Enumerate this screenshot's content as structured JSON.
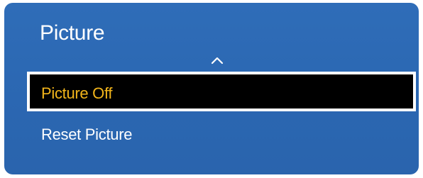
{
  "menu": {
    "title": "Picture",
    "scroll_up_icon": "chevron-up-icon",
    "items": [
      {
        "label": "Picture Off",
        "selected": true
      },
      {
        "label": "Reset Picture",
        "selected": false
      }
    ]
  },
  "colors": {
    "panel_background": "#2b67b2",
    "selected_background": "#000000",
    "selected_text": "#f2b51b",
    "selected_border": "#ffffff",
    "text": "#ffffff"
  }
}
